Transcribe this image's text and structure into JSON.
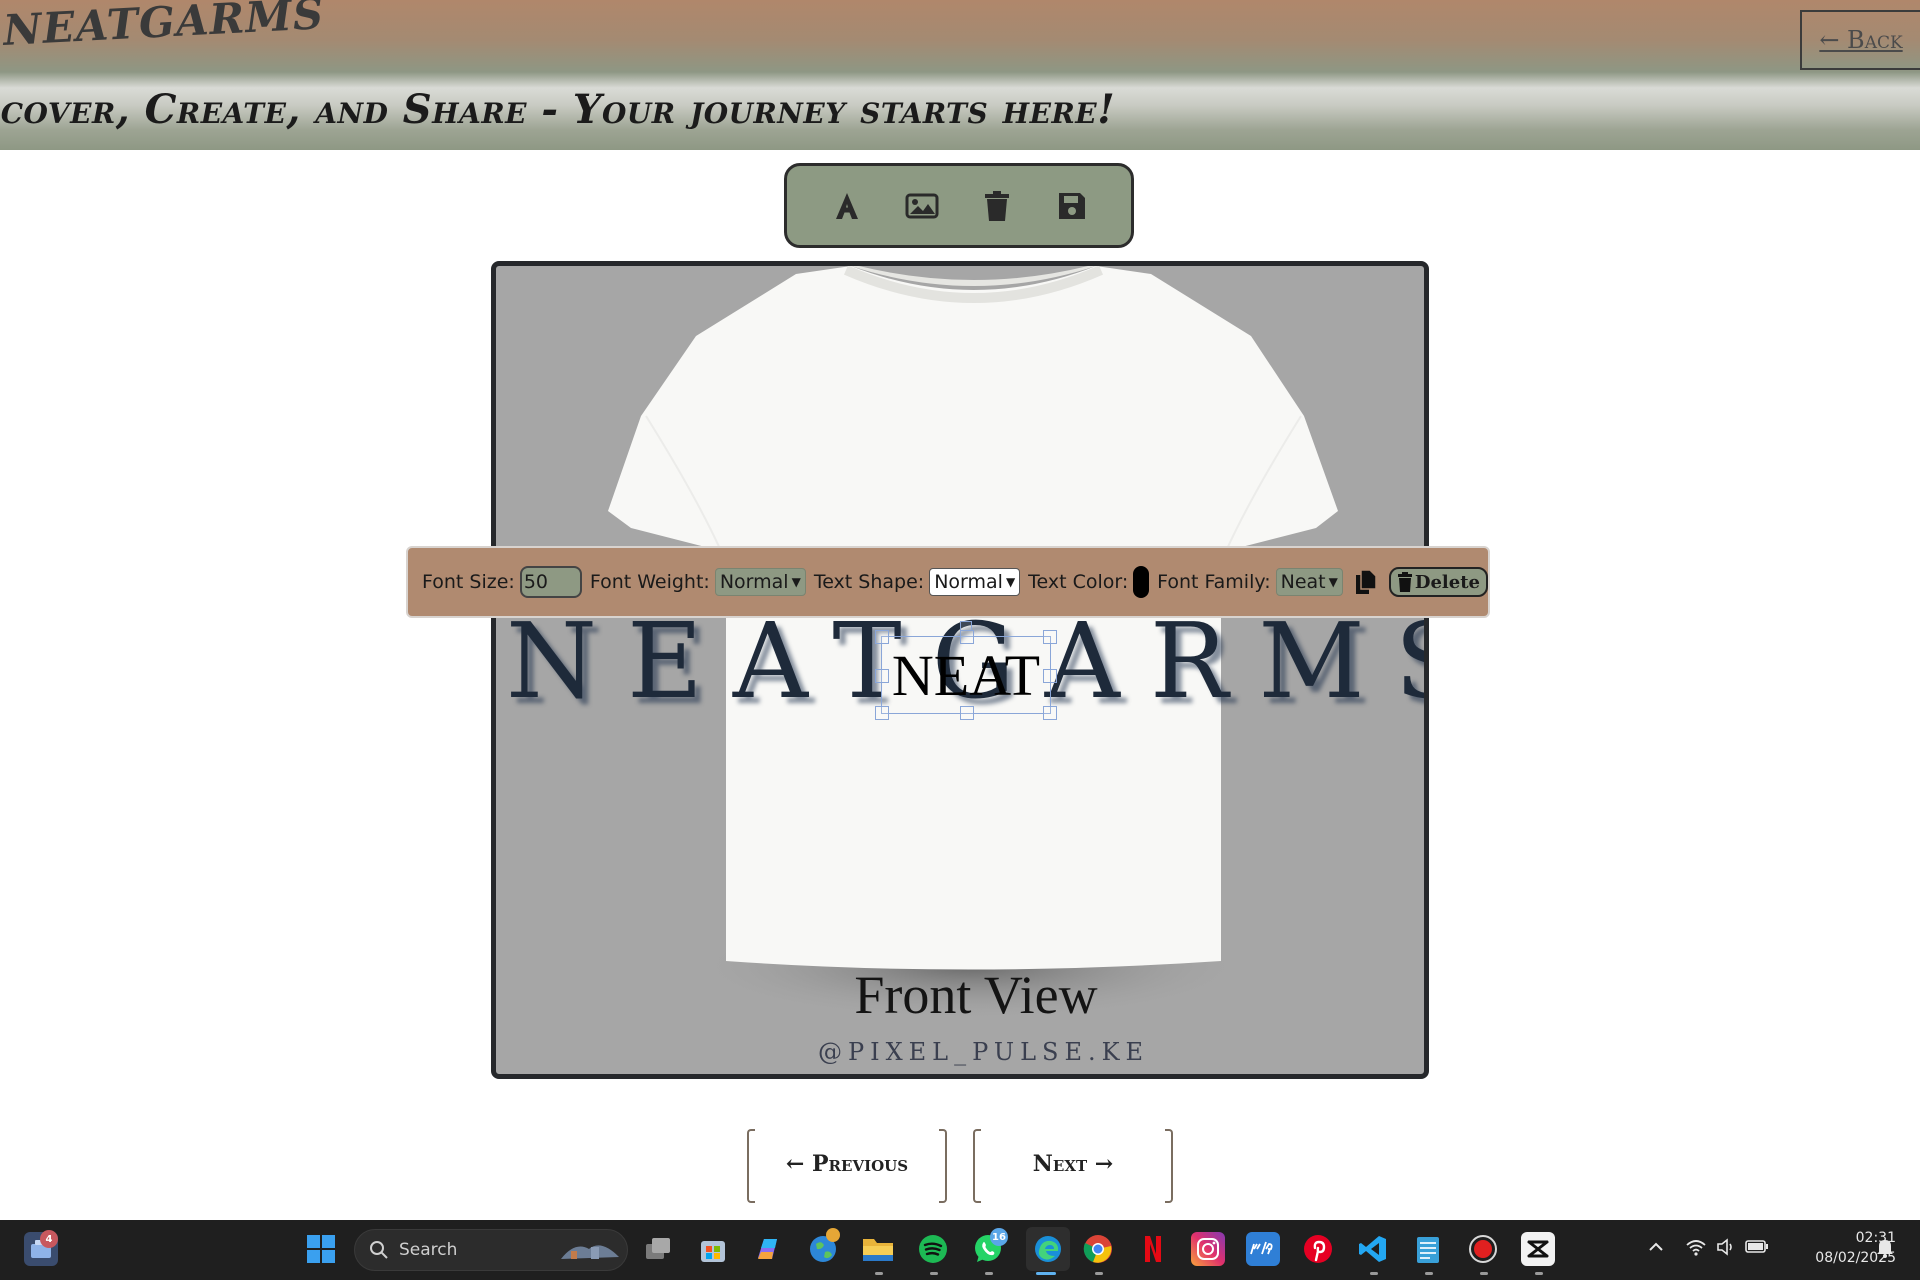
{
  "header": {
    "brand": "NEATGARMS",
    "back_label": "← Back",
    "tagline": "scover, Create, and Share - Your journey starts here!"
  },
  "toolbar": {
    "tools": [
      "text-icon",
      "image-icon",
      "trash-icon",
      "save-icon"
    ]
  },
  "canvas": {
    "background_brand": "NEATGARMS",
    "front_view_label": "Front View",
    "handle": "@PIXEL_PULSE.KE",
    "selected_text": "NEAT"
  },
  "text_options": {
    "font_size_label": "Font Size:",
    "font_size_value": "50",
    "font_weight_label": "Font Weight:",
    "font_weight_value": "Normal",
    "text_shape_label": "Text Shape:",
    "text_shape_value": "Normal",
    "text_color_label": "Text Color:",
    "text_color_value": "#000000",
    "font_family_label": "Font Family:",
    "font_family_value": "Neat",
    "delete_label": "Delete"
  },
  "pager": {
    "previous_label": "← Previous",
    "next_label": "Next →"
  },
  "taskbar": {
    "search_placeholder": "Search",
    "widgets_badge": "4",
    "whatsapp_badge": "16",
    "time": "02:31",
    "date": "08/02/2025"
  },
  "colors": {
    "header_top": "#b0876b",
    "header_bottom": "#8e9884",
    "toolbar_bg": "#8d9a83",
    "options_bg": "#b08a70",
    "canvas_bg": "#a6a6a6"
  }
}
